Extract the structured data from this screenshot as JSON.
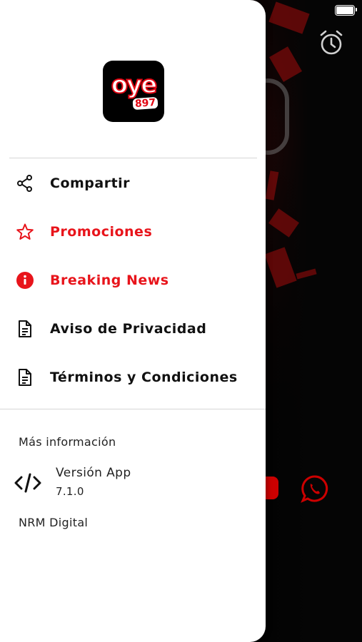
{
  "app": {
    "logo_text": "oye",
    "logo_number": "897"
  },
  "menu": {
    "items": [
      {
        "label": "Compartir",
        "icon": "share-icon",
        "color": "#111111"
      },
      {
        "label": "Promociones",
        "icon": "star-icon",
        "color": "#e8141b"
      },
      {
        "label": "Breaking News",
        "icon": "info-icon",
        "color": "#e8141b"
      },
      {
        "label": "Aviso de Privacidad",
        "icon": "document-icon",
        "color": "#111111"
      },
      {
        "label": "Términos y Condiciones",
        "icon": "document-icon",
        "color": "#111111"
      }
    ]
  },
  "info": {
    "section_title": "Más información",
    "version_label": "Versión App",
    "version_value": "7.1.0",
    "footer": "NRM Digital"
  },
  "colors": {
    "accent": "#e8141b",
    "drawer_bg": "#ffffff",
    "background": "#000000"
  }
}
